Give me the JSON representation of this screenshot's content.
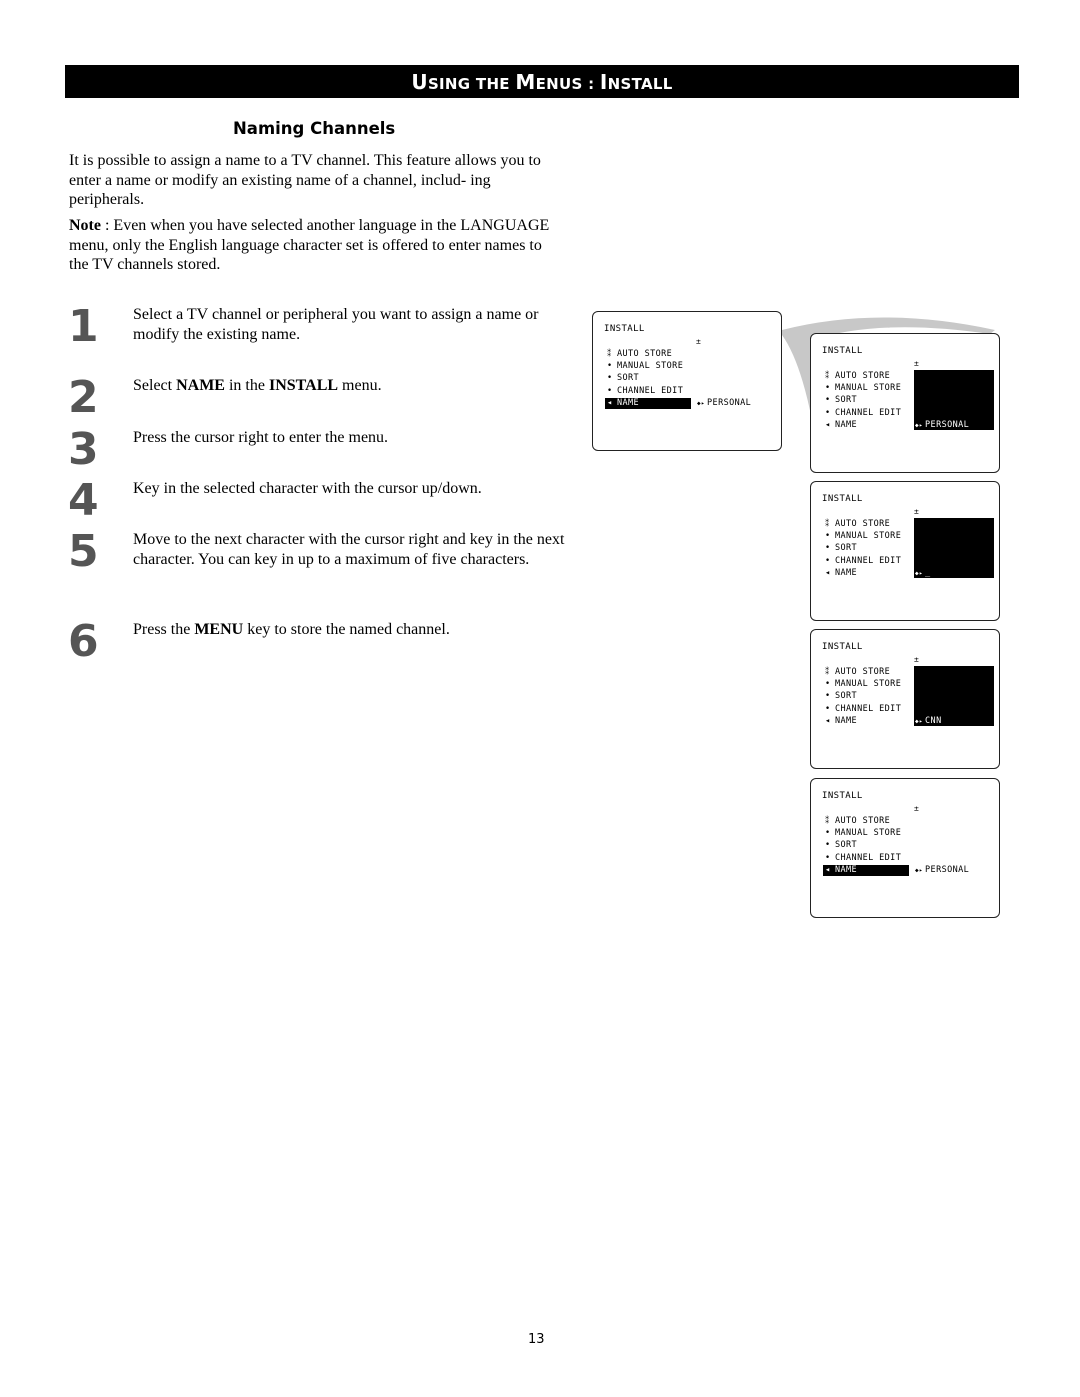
{
  "header": {
    "title_parts": [
      "U",
      "SING THE ",
      "M",
      "ENUS : ",
      "I",
      "NSTALL"
    ]
  },
  "section": {
    "title": "Naming Channels",
    "intro": "It is possible to assign a name to a TV channel. This feature allows you to enter a name or modify an existing name of a channel, includ- ing peripherals.",
    "note_label": "Note",
    "note_text": " : Even when you have selected another language in the LANGUAGE menu, only the English language character set is offered to enter names to the TV channels stored."
  },
  "steps": [
    {
      "num": "1",
      "parts": [
        {
          "t": "Select a TV channel or peripheral you want to assign a name or modify the existing name.",
          "b": false
        }
      ]
    },
    {
      "num": "2",
      "parts": [
        {
          "t": "Select ",
          "b": false
        },
        {
          "t": "NAME",
          "b": true
        },
        {
          "t": " in the ",
          "b": false
        },
        {
          "t": "INSTALL",
          "b": true
        },
        {
          "t": " menu.",
          "b": false
        }
      ]
    },
    {
      "num": "3",
      "parts": [
        {
          "t": "Press the cursor right to enter the menu.",
          "b": false
        }
      ]
    },
    {
      "num": "4",
      "parts": [
        {
          "t": "Key in the selected character with the cursor up/down.",
          "b": false
        }
      ]
    },
    {
      "num": "5",
      "parts": [
        {
          "t": "Move to the next character with the cursor right and key in the next character. You can key in up to a maximum of five characters.",
          "b": false
        }
      ]
    },
    {
      "num": "6",
      "parts": [
        {
          "t": "Press the ",
          "b": false
        },
        {
          "t": "MENU",
          "b": true
        },
        {
          "t": " key to store the named channel.",
          "b": false
        }
      ]
    }
  ],
  "screens": [
    {
      "title": "INSTALL",
      "updown_icon": "±",
      "items": [
        {
          "bullet": "⁑",
          "label": "AUTO STORE"
        },
        {
          "bullet": "•",
          "label": "MANUAL STORE"
        },
        {
          "bullet": "•",
          "label": "SORT"
        },
        {
          "bullet": "•",
          "label": "CHANNEL EDIT"
        },
        {
          "bullet": "◂",
          "label": "NAME"
        }
      ],
      "selected_index": 4,
      "value_arrow": "◆▸",
      "value": "PERSONAL",
      "panel_active": false
    },
    {
      "title": "INSTALL",
      "updown_icon": "±",
      "items": [
        {
          "bullet": "⁑",
          "label": "AUTO STORE"
        },
        {
          "bullet": "•",
          "label": "MANUAL STORE"
        },
        {
          "bullet": "•",
          "label": "SORT"
        },
        {
          "bullet": "•",
          "label": "CHANNEL EDIT"
        },
        {
          "bullet": "◂",
          "label": "NAME"
        }
      ],
      "selected_index": -1,
      "value_arrow": "◆▸",
      "value": "PERSONAL",
      "panel_active": true
    },
    {
      "title": "INSTALL",
      "updown_icon": "±",
      "items": [
        {
          "bullet": "⁑",
          "label": "AUTO STORE"
        },
        {
          "bullet": "•",
          "label": "MANUAL STORE"
        },
        {
          "bullet": "•",
          "label": "SORT"
        },
        {
          "bullet": "•",
          "label": "CHANNEL EDIT"
        },
        {
          "bullet": "◂",
          "label": "NAME"
        }
      ],
      "selected_index": -1,
      "value_arrow": "◆▸",
      "value": "_",
      "panel_active": true
    },
    {
      "title": "INSTALL",
      "updown_icon": "±",
      "items": [
        {
          "bullet": "⁑",
          "label": "AUTO STORE"
        },
        {
          "bullet": "•",
          "label": "MANUAL STORE"
        },
        {
          "bullet": "•",
          "label": "SORT"
        },
        {
          "bullet": "•",
          "label": "CHANNEL EDIT"
        },
        {
          "bullet": "◂",
          "label": "NAME"
        }
      ],
      "selected_index": -1,
      "value_arrow": "◆▸",
      "value": "CNN",
      "panel_active": true
    },
    {
      "title": "INSTALL",
      "updown_icon": "±",
      "items": [
        {
          "bullet": "⁑",
          "label": "AUTO STORE"
        },
        {
          "bullet": "•",
          "label": "MANUAL STORE"
        },
        {
          "bullet": "•",
          "label": "SORT"
        },
        {
          "bullet": "•",
          "label": "CHANNEL EDIT"
        },
        {
          "bullet": "◂",
          "label": "NAME"
        }
      ],
      "selected_index": 4,
      "value_arrow": "◆▸",
      "value": "PERSONAL",
      "panel_active": false
    }
  ],
  "colors": {
    "header_bg": "#000000",
    "header_text": "#ffffff",
    "step_number": "#555555",
    "connector": "#c8c8c8"
  },
  "page_number": "13"
}
